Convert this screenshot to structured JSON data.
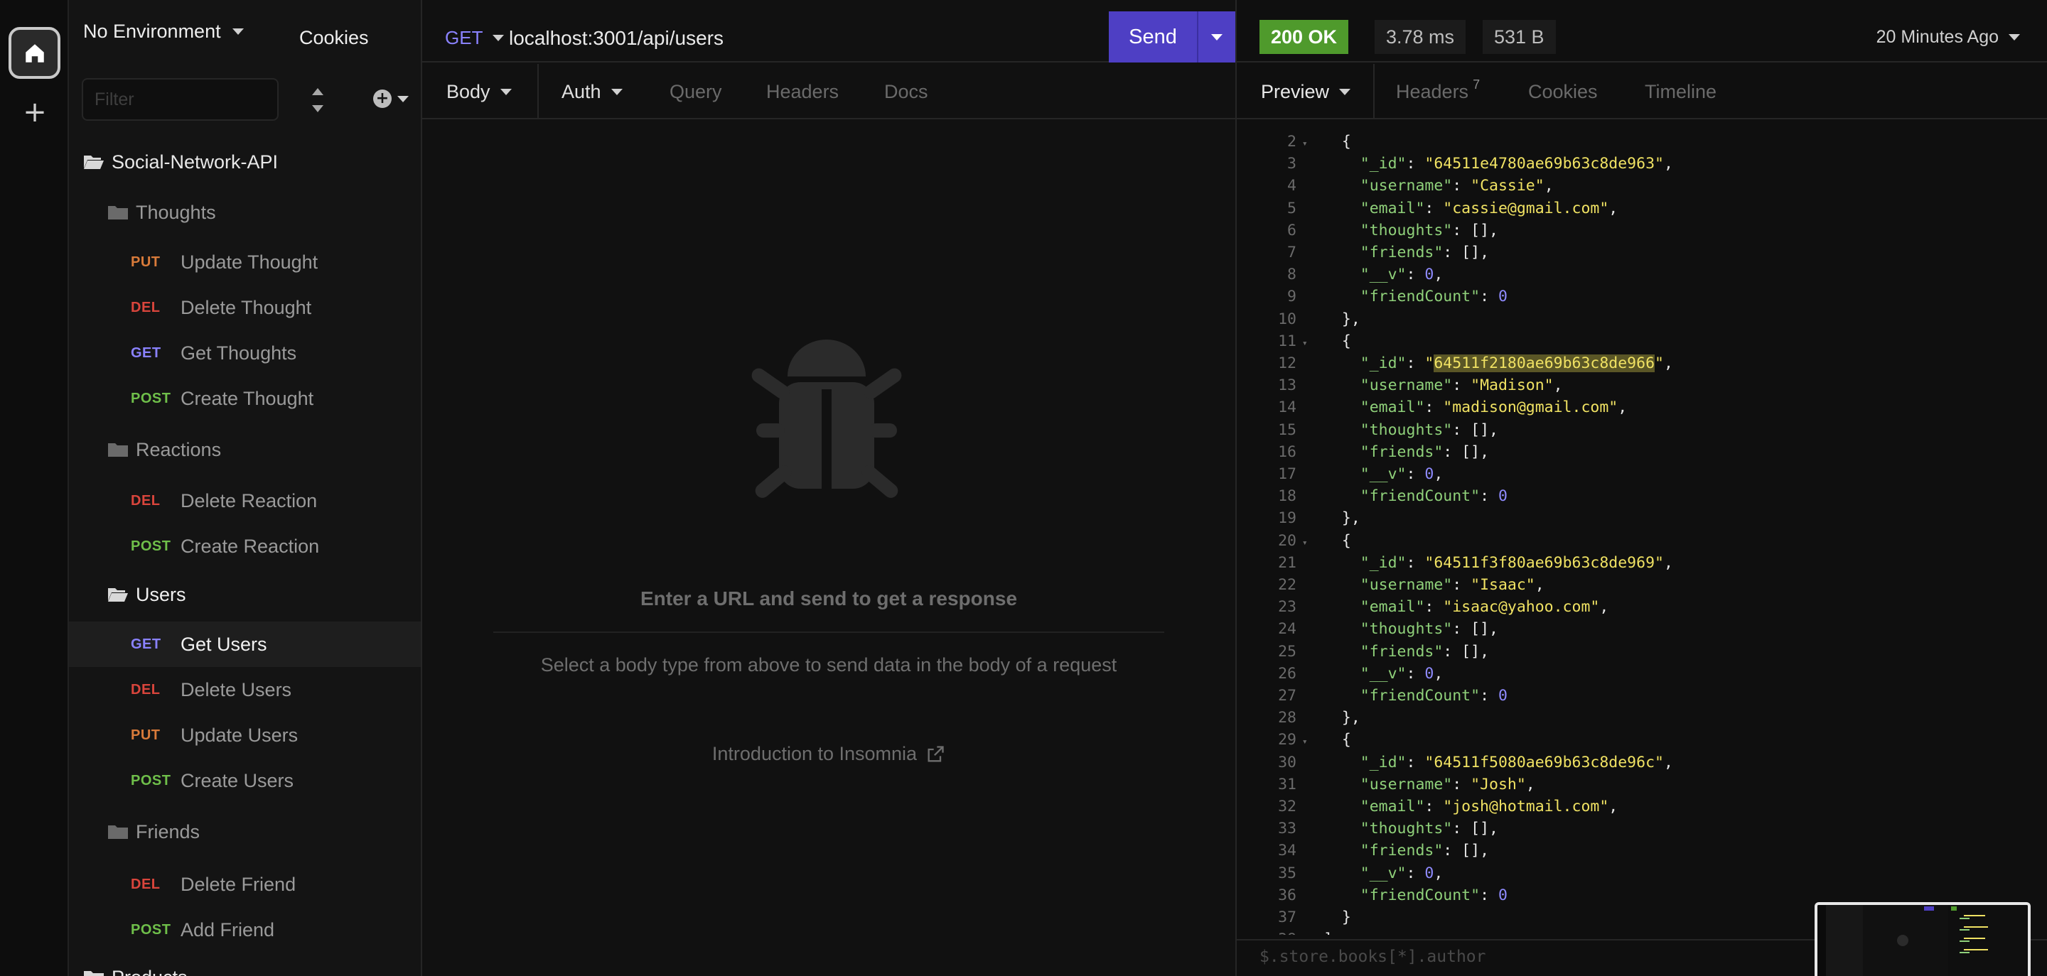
{
  "sidebar": {
    "environment": "No Environment",
    "cookies": "Cookies",
    "filter_placeholder": "Filter",
    "tree": [
      {
        "kind": "folder",
        "label": "Social-Network-API",
        "level": "root"
      },
      {
        "kind": "folder",
        "label": "Thoughts",
        "level": "sub"
      },
      {
        "kind": "request",
        "method": "PUT",
        "label": "Update Thought"
      },
      {
        "kind": "request",
        "method": "DEL",
        "label": "Delete Thought"
      },
      {
        "kind": "request",
        "method": "GET",
        "label": "Get Thoughts"
      },
      {
        "kind": "request",
        "method": "POST",
        "label": "Create Thought"
      },
      {
        "kind": "folder",
        "label": "Reactions",
        "level": "sub"
      },
      {
        "kind": "request",
        "method": "DEL",
        "label": "Delete Reaction"
      },
      {
        "kind": "request",
        "method": "POST",
        "label": "Create Reaction"
      },
      {
        "kind": "folder",
        "label": "Users",
        "level": "sub-open"
      },
      {
        "kind": "request",
        "method": "GET",
        "label": "Get Users",
        "active": true
      },
      {
        "kind": "request",
        "method": "DEL",
        "label": "Delete Users"
      },
      {
        "kind": "request",
        "method": "PUT",
        "label": "Update Users"
      },
      {
        "kind": "request",
        "method": "POST",
        "label": "Create Users"
      },
      {
        "kind": "folder",
        "label": "Friends",
        "level": "sub"
      },
      {
        "kind": "request",
        "method": "DEL",
        "label": "Delete Friend"
      },
      {
        "kind": "request",
        "method": "POST",
        "label": "Add Friend"
      },
      {
        "kind": "folder",
        "label": "Products",
        "level": "root-closed"
      }
    ]
  },
  "request": {
    "method": "GET",
    "url": "localhost:3001/api/users",
    "send_label": "Send",
    "tabs": {
      "body": "Body",
      "auth": "Auth",
      "query": "Query",
      "headers": "Headers",
      "docs": "Docs"
    },
    "empty_title": "Enter a URL and send to get a response",
    "empty_subtitle": "Select a body type from above to send data in the body of a request",
    "intro_link": "Introduction to Insomnia"
  },
  "response": {
    "status": "200 OK",
    "time": "3.78 ms",
    "size": "531 B",
    "time_ago": "20 Minutes Ago",
    "tabs": {
      "preview": "Preview",
      "headers": "Headers",
      "headers_count": "7",
      "cookies": "Cookies",
      "timeline": "Timeline"
    },
    "users": [
      {
        "_id": "64511e4780ae69b63c8de963",
        "username": "Cassie",
        "email": "cassie@gmail.com",
        "thoughts": "[]",
        "friends": "[]",
        "__v": "0",
        "friendCount": "0"
      },
      {
        "_id": "64511f2180ae69b63c8de966",
        "username": "Madison",
        "email": "madison@gmail.com",
        "thoughts": "[]",
        "friends": "[]",
        "__v": "0",
        "friendCount": "0"
      },
      {
        "_id": "64511f3f80ae69b63c8de969",
        "username": "Isaac",
        "email": "isaac@yahoo.com",
        "thoughts": "[]",
        "friends": "[]",
        "__v": "0",
        "friendCount": "0"
      },
      {
        "_id": "64511f5080ae69b63c8de96c",
        "username": "Josh",
        "email": "josh@hotmail.com",
        "thoughts": "[]",
        "friends": "[]",
        "__v": "0",
        "friendCount": "0"
      }
    ],
    "highlighted_value": "64511f2180ae69b63c8de966",
    "first_line_number": 2,
    "filter_placeholder": "$.store.books[*].author"
  },
  "colors": {
    "accent": "#4e3fc4",
    "status_ok": "#4f9a2c",
    "put": "#d97b3a",
    "del": "#d9453c",
    "get": "#8a82ff",
    "post": "#6fbf4a",
    "json_key": "#8fd07a",
    "json_string": "#f0e263",
    "json_number": "#8f8bff"
  }
}
